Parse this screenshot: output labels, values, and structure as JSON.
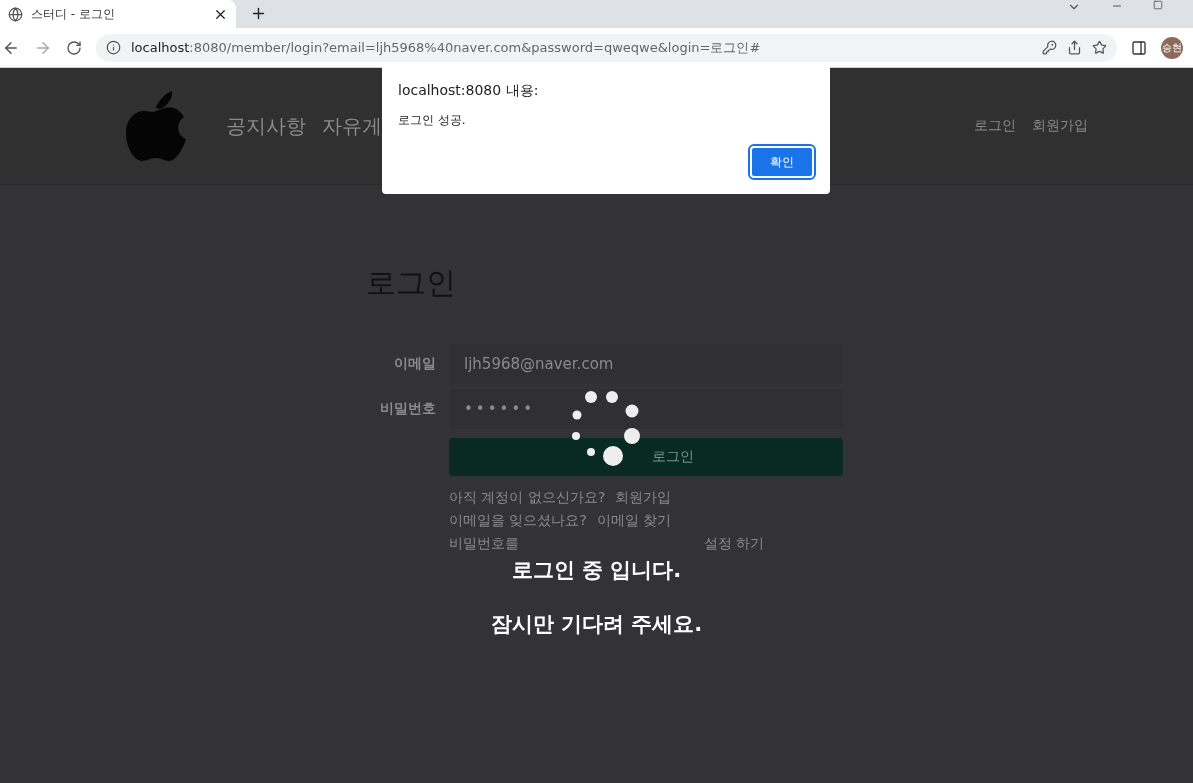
{
  "browser": {
    "tab": {
      "title": "스터디 - 로그인",
      "selected": true
    },
    "url": {
      "host": "localhost",
      "rest": ":8080/member/login?email=ljh5968%40naver.com&password=qweqwe&login=로그인#"
    },
    "profile": "승현"
  },
  "header": {
    "nav": [
      "공지사항",
      "자유게"
    ],
    "auth": [
      "로그인",
      "회원가입"
    ]
  },
  "login": {
    "title": "로그인",
    "fields": [
      {
        "label": "이메일",
        "value": "ljh5968@naver.com",
        "kind": "text"
      },
      {
        "label": "비밀번호",
        "value": "••••••",
        "kind": "password"
      }
    ],
    "button": "로그인",
    "links": [
      {
        "text": "아직 계정이 없으신가요?",
        "link": "회원가입"
      },
      {
        "text": "이메일을 잊으셨나요?",
        "link": "이메일 찾기"
      },
      {
        "text": "비밀번호를",
        "link": "설정 하기"
      }
    ]
  },
  "overlay": {
    "messages": [
      "로그인 중 입니다.",
      "잠시만 기다려 주세요."
    ]
  },
  "dialog": {
    "title": "localhost:8080 내용:",
    "message": "로그인 성공.",
    "button": "확인"
  }
}
